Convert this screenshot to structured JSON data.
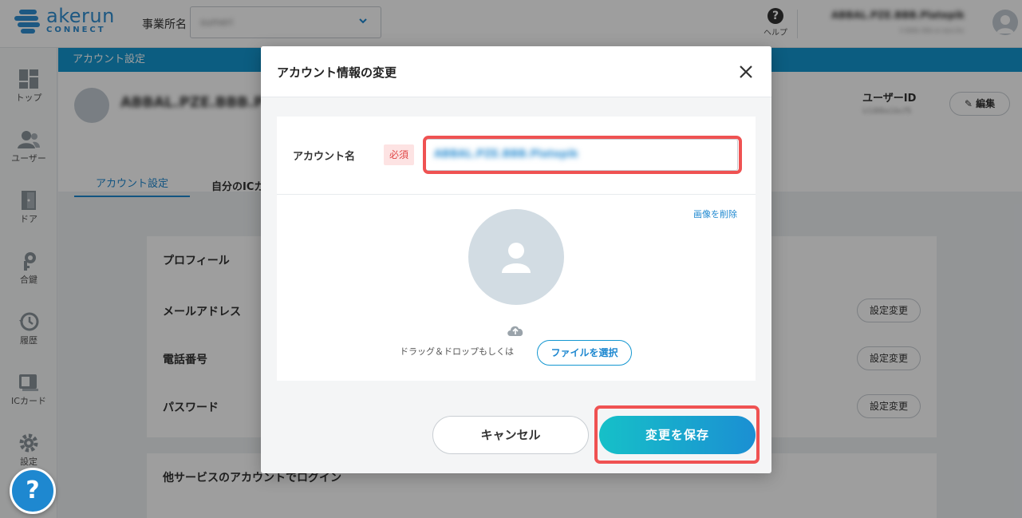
{
  "header": {
    "logo_name": "akerun",
    "logo_sub": "CONNECT",
    "office_label": "事業所名",
    "office_value": "sumeri",
    "help_label": "ヘルプ",
    "user_name": "ABBAL.PZE.BBB.Platepik",
    "user_sub": "t-bbb-ibb-e-sss-ks"
  },
  "sidebar": {
    "items": [
      {
        "label": "トップ",
        "icon": "dashboard-icon"
      },
      {
        "label": "ユーザー",
        "icon": "users-icon"
      },
      {
        "label": "ドア",
        "icon": "door-icon"
      },
      {
        "label": "合鍵",
        "icon": "key-icon"
      },
      {
        "label": "履歴",
        "icon": "history-icon"
      },
      {
        "label": "ICカード",
        "icon": "card-icon"
      },
      {
        "label": "設定",
        "icon": "gear-icon"
      }
    ],
    "help_fab": "?"
  },
  "page": {
    "title": "アカウント設定",
    "user_name": "ABBAL.PZE.BBB.Pl",
    "user_id_label": "ユーザーID",
    "user_id_value": "U1BBa1bcf5",
    "edit_button": "編集",
    "tabs": [
      "アカウント設定",
      "自分のICカ"
    ],
    "profile_title": "プロフィール",
    "rows": [
      {
        "label": "メールアドレス",
        "button": "設定変更"
      },
      {
        "label": "電話番号",
        "button": "設定変更"
      },
      {
        "label": "パスワード",
        "button": "設定変更"
      }
    ],
    "other_login": "他サービスのアカウントでログイン"
  },
  "modal": {
    "title": "アカウント情報の変更",
    "field_label": "アカウント名",
    "required_badge": "必須",
    "name_value": "ABBAL.PZE.BBB.Platepik",
    "delete_image": "画像を削除",
    "drop_text": "ドラッグ＆ドロップもしくは",
    "file_button": "ファイルを選択",
    "cancel_button": "キャンセル",
    "save_button": "変更を保存"
  },
  "colors": {
    "accent": "#1e88d0",
    "highlight": "#ef5252",
    "required": "#e04848"
  }
}
